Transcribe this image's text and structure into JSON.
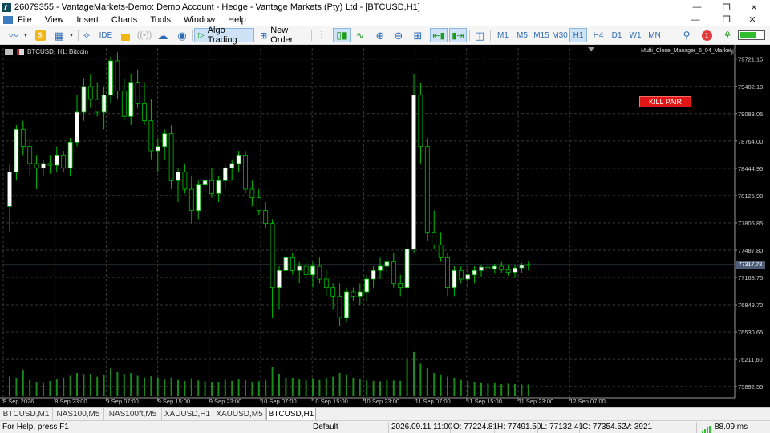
{
  "window": {
    "title": "26079355 - VantageMarkets-Demo: Demo Account - Hedge - Vantage Markets (Pty) Ltd - [BTCUSD,H1]",
    "minimize": "—",
    "maximize": "❐",
    "close": "✕"
  },
  "menu": {
    "items": [
      "File",
      "View",
      "Insert",
      "Charts",
      "Tools",
      "Window",
      "Help"
    ],
    "mdi_minimize": "—",
    "mdi_restore": "❐",
    "mdi_close": "✕"
  },
  "toolbar": {
    "ide_label": "IDE",
    "algo_trading_label": "Algo Trading",
    "new_order_label": "New Order",
    "timeframes": [
      "M1",
      "M5",
      "M15",
      "M30",
      "H1",
      "H4",
      "D1",
      "W1",
      "MN"
    ],
    "active_timeframe": "H1",
    "notification_count": "1",
    "battery_level": 0.7
  },
  "chart": {
    "symbol_label": "BTCUSD, H1:  Bitcoin",
    "ea_label": "Multi_Close_Manager_6_04_Market",
    "kill_button_label": "KILL PAIR",
    "current_price_label": "77317.78",
    "background": "#000000",
    "candle_bull": "#ffffff",
    "candle_bear": "#000000",
    "candle_outline": "#00c000",
    "grid_color": "#3a3a3a",
    "price_line_color": "#4d5f78"
  },
  "chart_data": {
    "type": "candlestick",
    "timeframe": "H1",
    "y_ticks": [
      "79721.15",
      "79402.10",
      "79083.05",
      "78764.00",
      "78444.95",
      "78125.90",
      "77806.85",
      "77487.80",
      "77168.75",
      "76849.70",
      "76530.65",
      "76211.60",
      "75892.55"
    ],
    "x_ticks": [
      "8 Sep 2026",
      "8 Sep 23:00",
      "9 Sep 07:00",
      "9 Sep 15:00",
      "9 Sep 23:00",
      "10 Sep 07:00",
      "10 Sep 15:00",
      "10 Sep 23:00",
      "11 Sep 07:00",
      "11 Sep 15:00",
      "11 Sep 23:00",
      "12 Sep 07:00"
    ],
    "ylim": [
      75800,
      79850
    ],
    "last_price": 77317.78,
    "grid": true,
    "candles": [
      [
        78000,
        78500,
        77700,
        78400
      ],
      [
        78400,
        78950,
        78300,
        78900
      ],
      [
        78900,
        79000,
        78600,
        78700
      ],
      [
        78700,
        78800,
        78350,
        78500
      ],
      [
        78500,
        78600,
        78200,
        78450
      ],
      [
        78450,
        78550,
        78350,
        78500
      ],
      [
        78500,
        78600,
        78380,
        78480
      ],
      [
        78480,
        78700,
        78400,
        78600
      ],
      [
        78600,
        78650,
        78400,
        78450
      ],
      [
        78450,
        78800,
        78350,
        78750
      ],
      [
        78750,
        79300,
        78700,
        79100
      ],
      [
        79100,
        79500,
        79000,
        79400
      ],
      [
        79400,
        79550,
        79150,
        79250
      ],
      [
        79250,
        79450,
        79050,
        79100
      ],
      [
        79100,
        79400,
        78900,
        79300
      ],
      [
        79300,
        79750,
        79200,
        79700
      ],
      [
        79700,
        79800,
        79250,
        79350
      ],
      [
        79350,
        79500,
        79000,
        79050
      ],
      [
        79050,
        79550,
        78950,
        79450
      ],
      [
        79450,
        79600,
        79150,
        79200
      ],
      [
        79200,
        79450,
        78950,
        79000
      ],
      [
        79000,
        79250,
        78550,
        78650
      ],
      [
        78650,
        78800,
        78400,
        78700
      ],
      [
        78700,
        78900,
        78550,
        78850
      ],
      [
        78850,
        78950,
        78200,
        78300
      ],
      [
        78300,
        78450,
        78050,
        78400
      ],
      [
        78400,
        78500,
        78150,
        78200
      ],
      [
        78200,
        78350,
        77800,
        77950
      ],
      [
        77950,
        78300,
        77850,
        78250
      ],
      [
        78250,
        78400,
        78150,
        78300
      ],
      [
        78300,
        78450,
        78100,
        78150
      ],
      [
        78150,
        78350,
        78050,
        78300
      ],
      [
        78300,
        78500,
        78200,
        78450
      ],
      [
        78450,
        78550,
        78300,
        78500
      ],
      [
        78500,
        78650,
        78400,
        78600
      ],
      [
        78600,
        78650,
        78150,
        78200
      ],
      [
        78200,
        78300,
        78000,
        78100
      ],
      [
        78100,
        78200,
        77900,
        77950
      ],
      [
        77950,
        78050,
        77750,
        77800
      ],
      [
        77800,
        77850,
        76700,
        77050
      ],
      [
        77050,
        77300,
        76800,
        77250
      ],
      [
        77250,
        77500,
        77150,
        77400
      ],
      [
        77400,
        77450,
        77200,
        77250
      ],
      [
        77250,
        77350,
        77100,
        77300
      ],
      [
        77300,
        77400,
        77150,
        77200
      ],
      [
        77200,
        77350,
        77050,
        77300
      ],
      [
        77300,
        77400,
        77100,
        77150
      ],
      [
        77150,
        77250,
        76950,
        77050
      ],
      [
        77050,
        77100,
        76800,
        76950
      ],
      [
        76950,
        77100,
        76600,
        76700
      ],
      [
        76700,
        77050,
        76650,
        77000
      ],
      [
        77000,
        77050,
        76900,
        76950
      ],
      [
        76950,
        77100,
        76850,
        77000
      ],
      [
        77000,
        77200,
        76900,
        77150
      ],
      [
        77150,
        77300,
        77050,
        77250
      ],
      [
        77250,
        77400,
        77150,
        77300
      ],
      [
        77300,
        77450,
        77200,
        77350
      ],
      [
        77350,
        77450,
        77050,
        77100
      ],
      [
        77100,
        77200,
        76950,
        77050
      ],
      [
        77050,
        77600,
        76000,
        77500
      ],
      [
        77500,
        79550,
        77450,
        79300
      ],
      [
        79300,
        79450,
        78500,
        78700
      ],
      [
        78700,
        78800,
        77600,
        77700
      ],
      [
        77700,
        77950,
        77500,
        77550
      ],
      [
        77550,
        77700,
        77350,
        77400
      ],
      [
        77400,
        77450,
        76950,
        77050
      ],
      [
        77050,
        77300,
        76950,
        77250
      ],
      [
        77250,
        77300,
        77100,
        77150
      ],
      [
        77150,
        77300,
        77050,
        77200
      ],
      [
        77200,
        77300,
        77100,
        77250
      ],
      [
        77250,
        77320,
        77180,
        77290
      ],
      [
        77290,
        77340,
        77200,
        77270
      ],
      [
        77270,
        77330,
        77210,
        77300
      ],
      [
        77300,
        77350,
        77220,
        77260
      ],
      [
        77260,
        77320,
        77190,
        77230
      ],
      [
        77230,
        77310,
        77160,
        77280
      ],
      [
        77280,
        77340,
        77220,
        77310
      ],
      [
        77310,
        77360,
        77250,
        77320
      ]
    ],
    "volumes": [
      0.42,
      0.38,
      0.55,
      0.35,
      0.3,
      0.28,
      0.33,
      0.36,
      0.4,
      0.44,
      0.5,
      0.46,
      0.48,
      0.42,
      0.45,
      0.6,
      0.52,
      0.47,
      0.5,
      0.44,
      0.4,
      0.43,
      0.38,
      0.36,
      0.4,
      0.35,
      0.33,
      0.37,
      0.34,
      0.32,
      0.3,
      0.31,
      0.35,
      0.33,
      0.36,
      0.34,
      0.3,
      0.32,
      0.34,
      0.62,
      0.48,
      0.4,
      0.38,
      0.36,
      0.34,
      0.37,
      0.35,
      0.38,
      0.42,
      0.5,
      0.45,
      0.38,
      0.36,
      0.34,
      0.33,
      0.32,
      0.35,
      0.34,
      0.33,
      0.78,
      0.95,
      0.7,
      0.6,
      0.5,
      0.45,
      0.42,
      0.38,
      0.35,
      0.32,
      0.3,
      0.28,
      0.27,
      0.28,
      0.26,
      0.27,
      0.26,
      0.25,
      0.25
    ]
  },
  "tabs": {
    "items": [
      "BTCUSD,M1",
      "NAS100,M5",
      "NAS100ft,M5",
      "XAUUSD,H1",
      "XAUUSD,M5",
      "BTCUSD,H1"
    ],
    "active": "BTCUSD,H1"
  },
  "status": {
    "help": "For Help, press F1",
    "profile": "Default",
    "datetime": "2026.09.11 11:00",
    "open": "O: 77224.81",
    "high": "H: 77491.50",
    "low": "L: 77132.41",
    "close": "C: 77354.52",
    "volume": "V: 3921",
    "ping": "88.09 ms"
  }
}
